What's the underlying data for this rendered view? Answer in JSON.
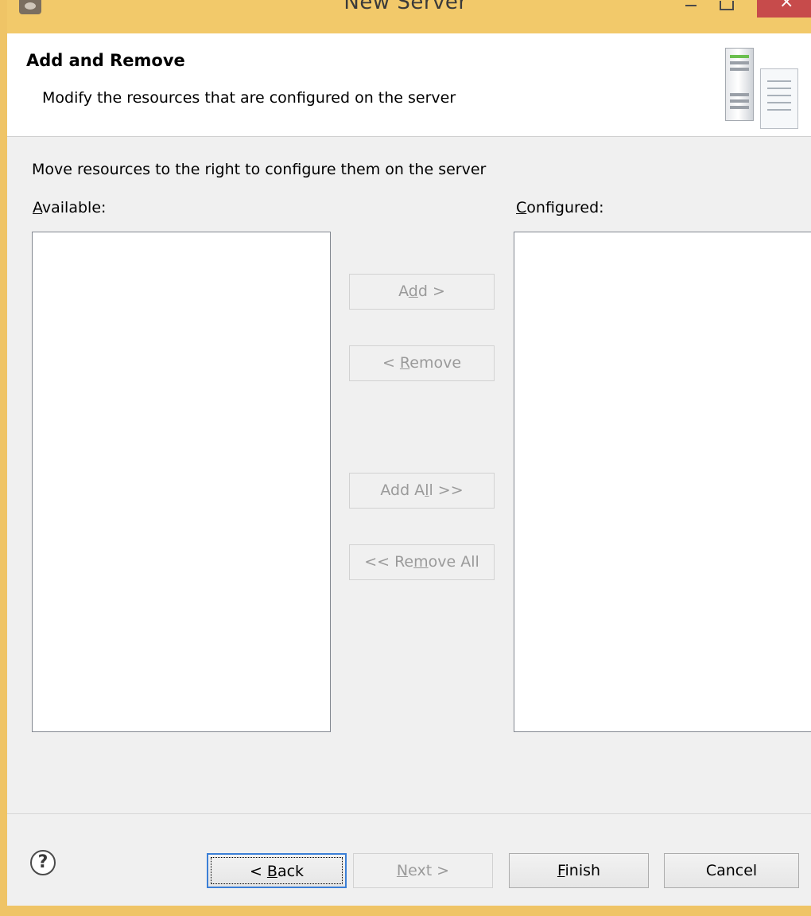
{
  "window": {
    "title": "New Server",
    "icon": "eclipse-app-icon"
  },
  "header": {
    "title": "Add and Remove",
    "description": "Modify the resources that are configured on the server",
    "image": "server-wizard-banner-icon"
  },
  "main": {
    "instructions": "Move resources to the right to configure them on the server",
    "available": {
      "label_mnemonic": "A",
      "label_rest": "vailable:",
      "items": []
    },
    "configured": {
      "label_mnemonic": "C",
      "label_rest": "onfigured:",
      "items": []
    },
    "buttons": {
      "add": {
        "pre": "A",
        "mnemonic": "d",
        "post": "d >",
        "enabled": false
      },
      "remove": {
        "pre": "< ",
        "mnemonic": "R",
        "post": "emove",
        "enabled": false
      },
      "add_all": {
        "pre": "Add A",
        "mnemonic": "l",
        "post": "l >>",
        "enabled": false
      },
      "remove_all": {
        "pre": "<< Re",
        "mnemonic": "m",
        "post": "ove All",
        "enabled": false
      }
    }
  },
  "footer": {
    "help_icon": "help-question-icon",
    "help_glyph": "?",
    "back": {
      "pre": "< ",
      "mnemonic": "B",
      "post": "ack",
      "enabled": true
    },
    "next": {
      "pre": "",
      "mnemonic": "N",
      "post": "ext >",
      "enabled": false
    },
    "finish": {
      "pre": "",
      "mnemonic": "F",
      "post": "inish",
      "enabled": true
    },
    "cancel": {
      "label": "Cancel",
      "enabled": true
    }
  },
  "colors": {
    "frame": "#f2c96a",
    "close_button": "#c74b4b",
    "focus_border": "#3b7fd6",
    "disabled_text": "#9a9a9a"
  }
}
